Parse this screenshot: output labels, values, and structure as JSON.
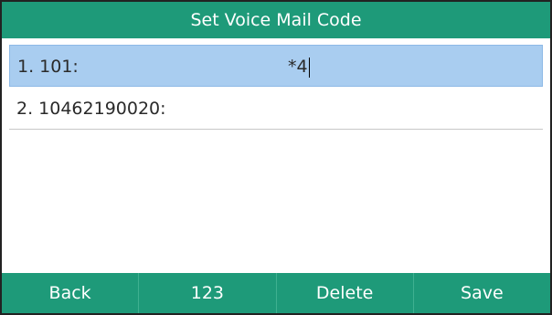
{
  "title": "Set Voice Mail Code",
  "rows": [
    {
      "label": "1. 101:",
      "value": "*4",
      "selected": true
    },
    {
      "label": "2. 10462190020:",
      "value": "",
      "selected": false
    }
  ],
  "softkeys": [
    {
      "label": "Back"
    },
    {
      "label": "123"
    },
    {
      "label": "Delete"
    },
    {
      "label": "Save"
    }
  ],
  "colors": {
    "accent": "#1e9a79",
    "selection": "#a9cdf0"
  }
}
